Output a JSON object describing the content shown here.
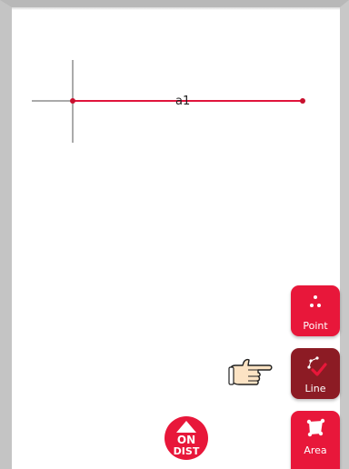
{
  "canvas": {
    "segment_label": "a1",
    "line_color": "#e0143c",
    "axis_color": "#555555"
  },
  "tools": {
    "point": {
      "label": "Point",
      "icon": "point-icon"
    },
    "line": {
      "label": "Line",
      "icon": "line-check-icon",
      "selected": true
    },
    "area": {
      "label": "Area",
      "icon": "area-icon"
    }
  },
  "dist_toggle": {
    "top": "ON",
    "bottom": "DIST",
    "icon": "on-dist-icon"
  },
  "pointer_hint": {
    "icon": "pointing-hand-icon"
  },
  "colors": {
    "accent": "#e8173a",
    "selected": "#8c1b24"
  }
}
